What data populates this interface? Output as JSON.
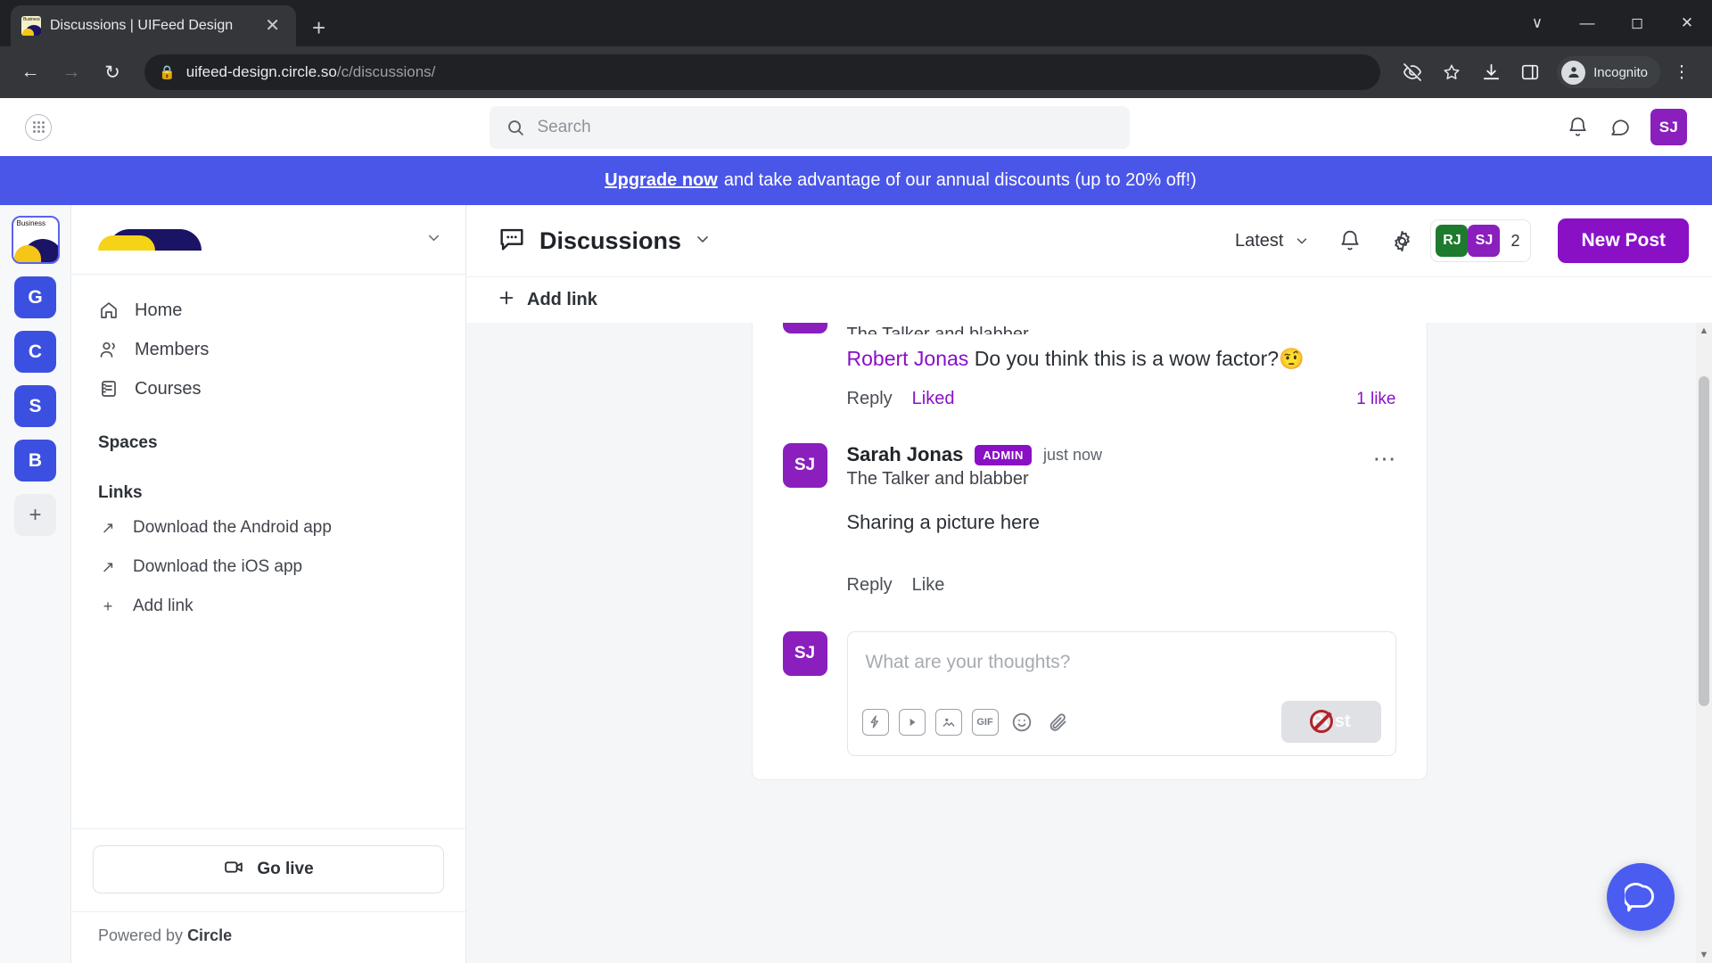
{
  "browser": {
    "tab": {
      "title": "Discussions | UIFeed Design",
      "close_icon": "close-icon",
      "favicon_label": "Business"
    },
    "new_tab_icon": "plus-icon",
    "window_controls": {
      "minimize": "⌄",
      "restore": "—",
      "maximize": "□",
      "close": "✕"
    },
    "nav": {
      "back_icon": "←",
      "forward_icon": "→",
      "reload_icon": "↻"
    },
    "omnibox": {
      "lock_icon": "🔒",
      "domain": "uifeed-design.circle.so",
      "path": "/c/discussions/"
    },
    "toolbar": {
      "hide_icon": "eye-off-icon",
      "bookmark_icon": "star-icon",
      "download_icon": "download-icon",
      "sidepanel_icon": "side-panel-icon",
      "incognito_label": "Incognito",
      "menu_icon": "kebab-menu-icon"
    }
  },
  "topbar": {
    "grid_icon": "app-grid-icon",
    "search": {
      "placeholder": "Search",
      "icon": "search-icon"
    },
    "bell_icon": "bell-icon",
    "chat_icon": "chat-bubble-icon",
    "avatar_initials": "SJ"
  },
  "banner": {
    "link_text": "Upgrade now",
    "text": "and take advantage of our annual discounts (up to 20% off!)",
    "color": "#4a56e8"
  },
  "rail": {
    "logo_label": "Business",
    "items": [
      {
        "label": "G"
      },
      {
        "label": "C"
      },
      {
        "label": "S"
      },
      {
        "label": "B"
      }
    ],
    "add_label": "+"
  },
  "sidebar": {
    "chevron_icon": "chevron-down-icon",
    "nav": [
      {
        "label": "Home",
        "icon": "home-icon"
      },
      {
        "label": "Members",
        "icon": "members-icon"
      },
      {
        "label": "Courses",
        "icon": "courses-icon"
      }
    ],
    "spaces_title": "Spaces",
    "links_title": "Links",
    "links": [
      {
        "label": "Download the Android app",
        "icon": "external-link-icon"
      },
      {
        "label": "Download the iOS app",
        "icon": "external-link-icon"
      },
      {
        "label": "Add link",
        "icon": "plus-icon"
      }
    ],
    "go_live": {
      "label": "Go live",
      "icon": "video-camera-icon"
    },
    "powered_prefix": "Powered by ",
    "powered_brand": "Circle"
  },
  "main": {
    "header": {
      "icon": "discussion-bubble-icon",
      "title": "Discussions",
      "chevron_icon": "chevron-down-icon",
      "sort_label": "Latest",
      "bell_icon": "bell-icon",
      "gear_icon": "gear-icon",
      "avatars": [
        {
          "initials": "RJ",
          "color": "#1e7a2e"
        },
        {
          "initials": "SJ",
          "color": "#8a1fbd"
        }
      ],
      "avatar_count": "2",
      "new_post_label": "New Post",
      "new_post_color": "#8a10c6"
    },
    "add_link_bar": {
      "label": "Add link",
      "icon": "plus-icon"
    },
    "comments": [
      {
        "truncated_sub": "The Talker and blabber",
        "mention": "Robert Jonas",
        "text": " Do you think this is a wow factor?🤨",
        "reply_label": "Reply",
        "like_label": "Liked",
        "liked": true,
        "likes_text": "1 like"
      },
      {
        "avatar_initials": "SJ",
        "name": "Sarah Jonas",
        "badge": "ADMIN",
        "time": "just now",
        "sub": "The Talker and blabber",
        "text": "Sharing a picture here",
        "reply_label": "Reply",
        "like_label": "Like",
        "more_icon": "ellipsis-icon"
      }
    ],
    "composer": {
      "avatar_initials": "SJ",
      "placeholder": "What are your thoughts?",
      "tools": [
        {
          "icon": "lightning-bolt-icon"
        },
        {
          "icon": "video-play-icon"
        },
        {
          "icon": "image-icon"
        },
        {
          "icon": "gif-icon",
          "label": "GIF"
        },
        {
          "icon": "emoji-smiley-icon"
        },
        {
          "icon": "paperclip-icon"
        }
      ],
      "post_label": "Post",
      "post_disabled": true
    },
    "chat_fab_icon": "chat-bubble-icon"
  }
}
